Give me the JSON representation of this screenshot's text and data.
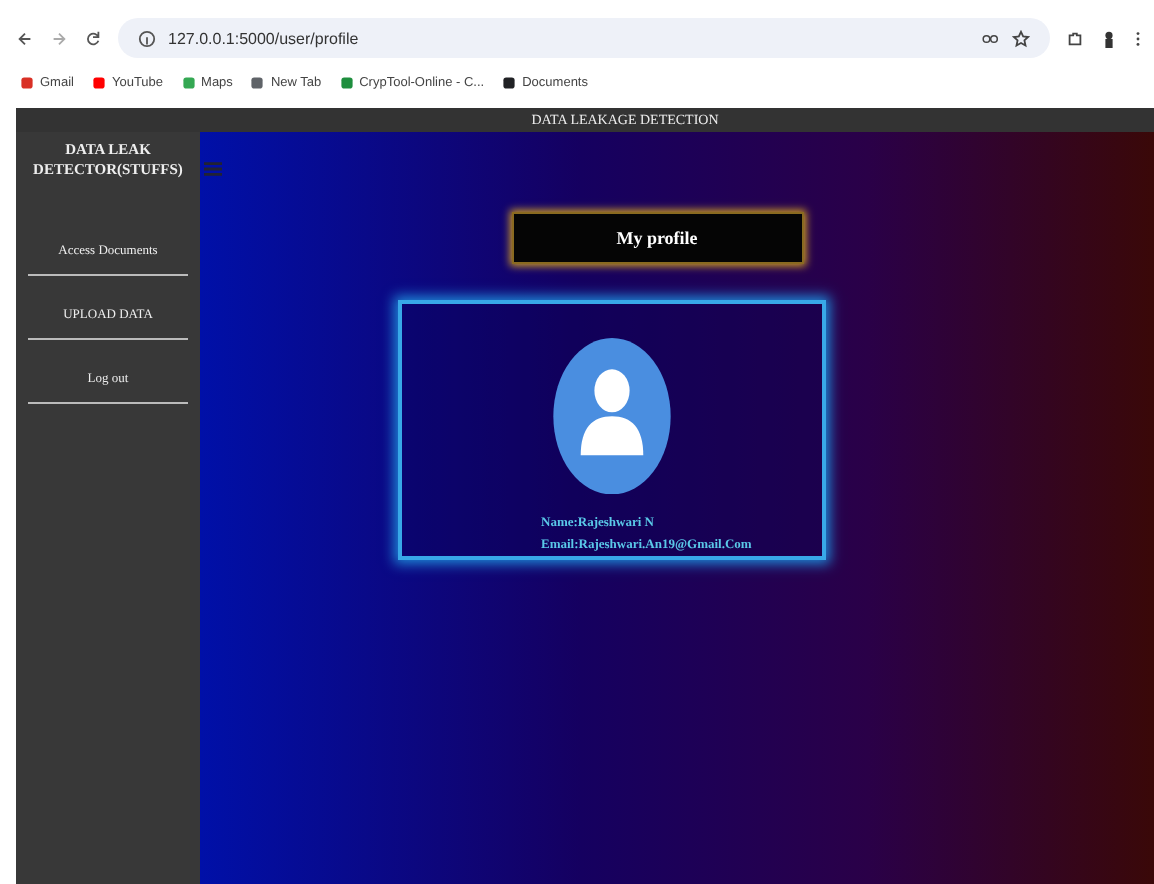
{
  "browser": {
    "url": "127.0.0.1:5000/user/profile",
    "bookmarks": [
      {
        "label": "Gmail",
        "color": "#d93025"
      },
      {
        "label": "YouTube",
        "color": "#ff0000"
      },
      {
        "label": "Maps",
        "color": "#34a853"
      },
      {
        "label": "New Tab",
        "color": "#5f6368"
      },
      {
        "label": "CrypTool-Online - C...",
        "color": "#1e8e3e"
      },
      {
        "label": "Documents",
        "color": "#202124"
      }
    ]
  },
  "header": {
    "title": "DATA LEAKAGE DETECTION"
  },
  "sidebar": {
    "brand": "DATA LEAK DETECTOR(STUFFS)",
    "items": [
      {
        "label": "Access Documents"
      },
      {
        "label": "UPLOAD DATA"
      },
      {
        "label": "Log out"
      }
    ]
  },
  "profile": {
    "heading": "My profile",
    "name": "Name:Rajeshwari N",
    "email": "Email:Rajeshwari.An19@Gmail.Com"
  }
}
